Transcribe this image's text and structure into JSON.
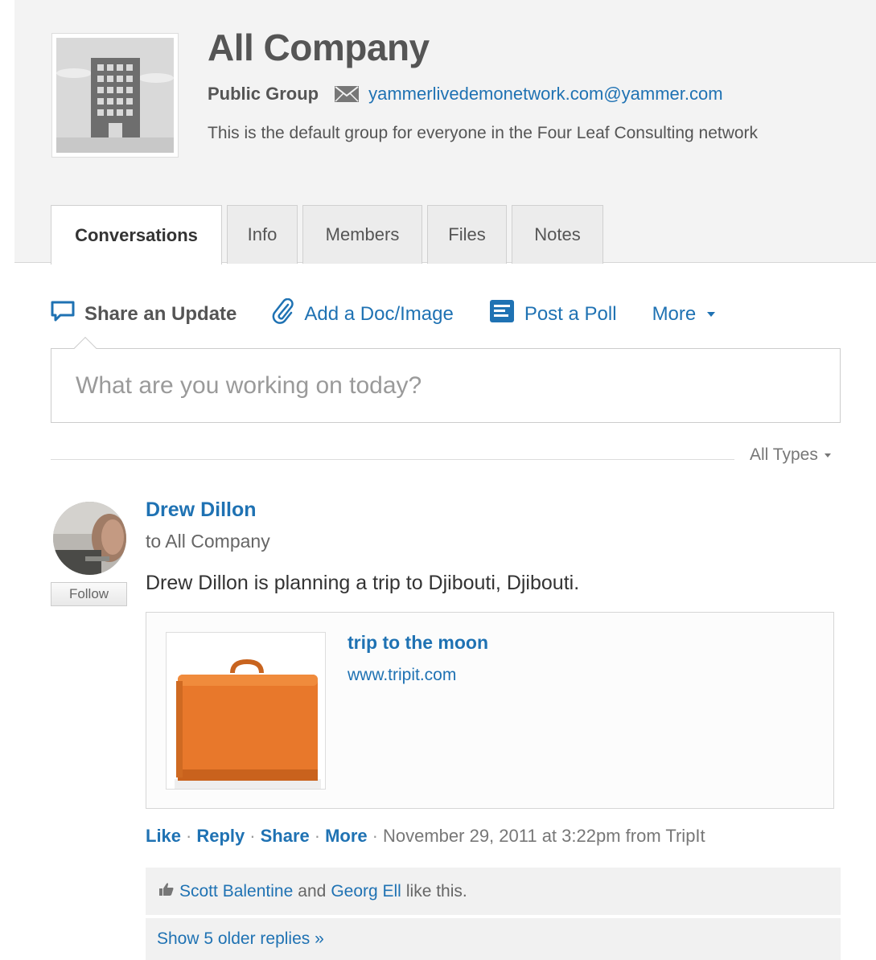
{
  "group": {
    "title": "All Company",
    "type": "Public Group",
    "email": "yammerlivedemonetwork.com@yammer.com",
    "description": "This is the default group for everyone in the Four Leaf Consulting network",
    "avatar_icon": "building-icon"
  },
  "tabs": [
    {
      "label": "Conversations",
      "active": true
    },
    {
      "label": "Info",
      "active": false
    },
    {
      "label": "Members",
      "active": false
    },
    {
      "label": "Files",
      "active": false
    },
    {
      "label": "Notes",
      "active": false
    }
  ],
  "publisher": {
    "share_update": "Share an Update",
    "add_doc": "Add a Doc/Image",
    "post_poll": "Post a Poll",
    "more": "More",
    "placeholder": "What are you working on today?"
  },
  "filter": {
    "label": "All Types"
  },
  "post": {
    "author": "Drew Dillon",
    "recipient": "to All Company",
    "follow_label": "Follow",
    "body": "Drew Dillon is planning a trip to Djibouti, Djibouti.",
    "attachment": {
      "title": "trip to the moon",
      "url": "www.tripit.com"
    },
    "actions": {
      "like": "Like",
      "reply": "Reply",
      "share": "Share",
      "more": "More",
      "separator": "·",
      "timestamp": "November 29, 2011 at 3:22pm from TripIt"
    },
    "likes": {
      "user1": "Scott Balentine",
      "and_text": "and",
      "user2": "Georg Ell",
      "suffix": "like this."
    },
    "older_replies": "Show 5 older replies »"
  },
  "colors": {
    "link": "#1f72b3",
    "header_bg": "#f3f3f3",
    "briefcase": "#e8782b"
  }
}
